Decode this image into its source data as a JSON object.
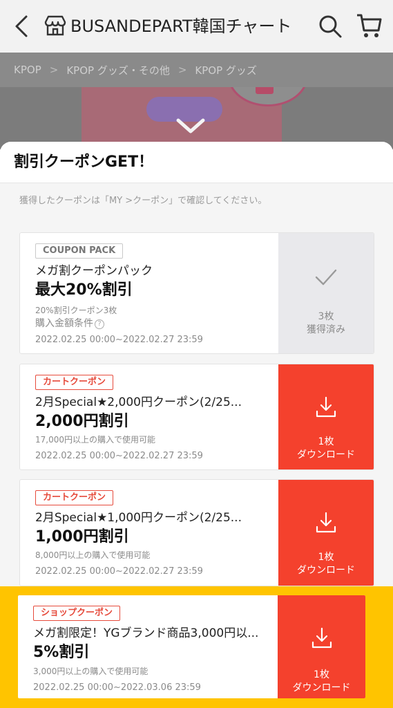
{
  "header": {
    "shop_title": "BUSANDEPART韓国チャート店"
  },
  "breadcrumb": [
    "KPOP",
    "KPOP グッズ・その他",
    "KPOP グッズ"
  ],
  "sheet": {
    "title": "割引クーポンGET！",
    "info": "獲得したクーポンは「MY >クーポン」で確認してください。"
  },
  "coupons": [
    {
      "tag": "COUPON PACK",
      "name": "メガ割クーポンパック",
      "amount": "最大20%割引",
      "condition": "20%割引クーポン3枚",
      "condition2": "購入金額条件",
      "date": "2022.02.25 00:00~2022.02.27 23:59",
      "action_line1": "3枚",
      "action_line2": "獲得済み",
      "state": "obtained"
    },
    {
      "tag": "カートクーポン",
      "name": "2月Special★2,000円クーポン(2/25...",
      "amount": "2,000円割引",
      "condition": "17,000円以上の購入で使用可能",
      "date": "2022.02.25 00:00~2022.02.27 23:59",
      "action_line1": "1枚",
      "action_line2": "ダウンロード",
      "state": "download"
    },
    {
      "tag": "カートクーポン",
      "name": "2月Special★1,000円クーポン(2/25...",
      "amount": "1,000円割引",
      "condition": "8,000円以上の購入で使用可能",
      "date": "2022.02.25 00:00~2022.02.27 23:59",
      "action_line1": "1枚",
      "action_line2": "ダウンロード",
      "state": "download"
    },
    {
      "tag": "ショップクーポン",
      "name": "メガ割限定！YGブランド商品3,000円以...",
      "amount": "5%割引",
      "condition": "3,000円以上の購入で使用可能",
      "date": "2022.02.25 00:00~2022.03.06 23:59",
      "action_line1": "1枚",
      "action_line2": "ダウンロード",
      "state": "download"
    }
  ],
  "icons": {
    "back": "chevron-left-icon",
    "shop": "store-icon",
    "search": "search-icon",
    "cart": "cart-icon",
    "obtained": "check-icon",
    "download": "download-icon"
  },
  "colors": {
    "accent_red": "#f4412d",
    "highlight_yellow": "#ffc400",
    "obtained_gray": "#e9e9ec"
  }
}
